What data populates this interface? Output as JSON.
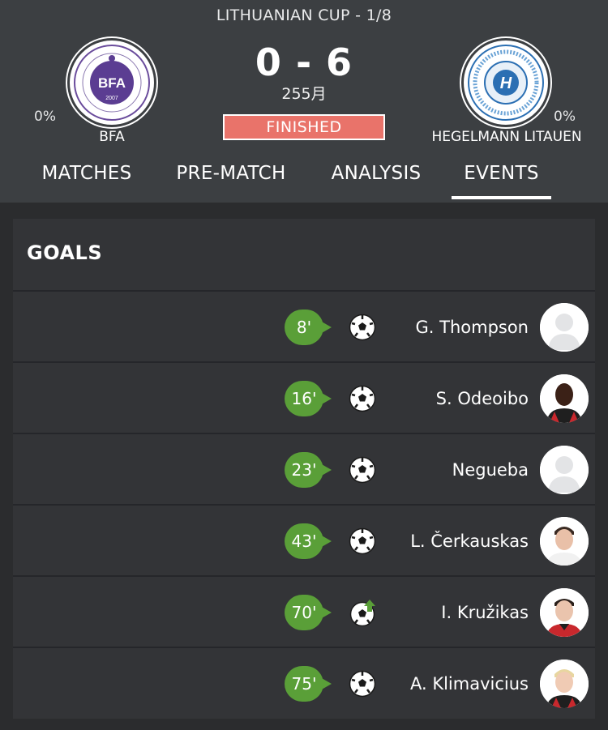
{
  "header": {
    "competition": "LITHUANIAN CUP - 1/8",
    "score": "0 - 6",
    "date": "255月",
    "status": "FINISHED",
    "home": {
      "name": "BFA",
      "percent": "0%",
      "crest_icon": "bfa-crest-icon",
      "crest_text": "BFA",
      "crest_year": "2007"
    },
    "away": {
      "name": "HEGELMANN LITAUEN",
      "percent": "0%",
      "crest_icon": "hegelmann-crest-icon",
      "crest_letter": "H"
    }
  },
  "tabs": [
    {
      "label": "MATCHES",
      "active": false
    },
    {
      "label": "PRE-MATCH",
      "active": false
    },
    {
      "label": "ANALYSIS",
      "active": false
    },
    {
      "label": "EVENTS",
      "active": true
    }
  ],
  "goals": {
    "title": "GOALS",
    "rows": [
      {
        "minute": "8'",
        "player": "G. Thompson",
        "icon": "football-icon",
        "avatar": "placeholder"
      },
      {
        "minute": "16'",
        "player": "S. Odeoibo",
        "icon": "football-icon",
        "avatar": "dark-skin"
      },
      {
        "minute": "23'",
        "player": "Negueba",
        "icon": "football-icon",
        "avatar": "placeholder"
      },
      {
        "minute": "43'",
        "player": "L. Čerkauskas",
        "icon": "football-icon",
        "avatar": "light-skin-white"
      },
      {
        "minute": "70'",
        "player": "I. Kružikas",
        "icon": "football-assist-icon",
        "avatar": "light-skin-red"
      },
      {
        "minute": "75'",
        "player": "A. Klimavicius",
        "icon": "football-icon",
        "avatar": "blond-red"
      }
    ]
  },
  "colors": {
    "header_bg": "#3c3f42",
    "page_bg": "#2b2c2e",
    "card_bg": "#333437",
    "minute_green": "#5a9f38",
    "status_red": "#e9736a"
  }
}
